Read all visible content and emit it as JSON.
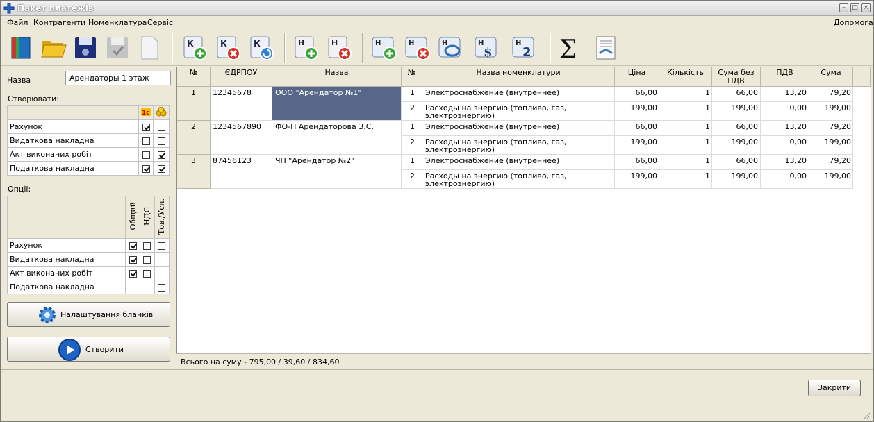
{
  "window": {
    "title": "Пакет платежів"
  },
  "menu": {
    "file": "Файл",
    "contractors": "Контрагенти",
    "nomenclature": "Номенклатура",
    "service": "Сервіс",
    "help": "Допомога"
  },
  "form": {
    "name_label": "Назва",
    "name_value": "Арендаторы 1 этаж",
    "create_label": "Створювати:",
    "options_label": "Опції:"
  },
  "create_table": {
    "rows": [
      {
        "label": "Рахунок",
        "c1": true,
        "c2": false
      },
      {
        "label": "Видаткова накладна",
        "c1": false,
        "c2": false
      },
      {
        "label": "Акт виконаних робіт",
        "c1": false,
        "c2": true
      },
      {
        "label": "Податкова накладна",
        "c1": true,
        "c2": true
      }
    ]
  },
  "options_table": {
    "headers": [
      "Общий",
      "НДС",
      "Тов./Усл."
    ],
    "rows": [
      {
        "label": "Рахунок",
        "c1": true,
        "c2": false,
        "c3": false
      },
      {
        "label": "Видаткова накладна",
        "c1": true,
        "c2": false,
        "c3": null
      },
      {
        "label": "Акт виконаних робіт",
        "c1": true,
        "c2": false,
        "c3": null
      },
      {
        "label": "Податкова накладна",
        "c1": null,
        "c2": null,
        "c3": false
      }
    ]
  },
  "buttons": {
    "settings": "Налаштування бланків",
    "create": "Створити",
    "close": "Закрити"
  },
  "grid": {
    "headers": {
      "num": "№",
      "edrpou": "ЄДРПОУ",
      "name": "Назва",
      "pos": "№",
      "nomen": "Назва номенклатури",
      "price": "Ціна",
      "qty": "Кількість",
      "sum_no_vat": "Сума без ПДВ",
      "vat": "ПДВ",
      "sum": "Сума"
    },
    "rows": [
      {
        "num": "1",
        "edrpou": "12345678",
        "name": "ООО \"Арендатор №1\"",
        "items": [
          {
            "pos": "1",
            "nomen": "Электроснабжение (внутреннее)",
            "nomen2": "",
            "price": "66,00",
            "qty": "1",
            "sum_no_vat": "66,00",
            "vat": "13,20",
            "sum": "79,20"
          },
          {
            "pos": "2",
            "nomen": "Расходы на энергию (топливо, газ,",
            "nomen2": "электроэнергию)",
            "price": "199,00",
            "qty": "1",
            "sum_no_vat": "199,00",
            "vat": "0,00",
            "sum": "199,00"
          }
        ]
      },
      {
        "num": "2",
        "edrpou": "1234567890",
        "name": "ФО-П Арендаторова З.С.",
        "items": [
          {
            "pos": "1",
            "nomen": "Электроснабжение (внутреннее)",
            "nomen2": "",
            "price": "66,00",
            "qty": "1",
            "sum_no_vat": "66,00",
            "vat": "13,20",
            "sum": "79,20"
          },
          {
            "pos": "2",
            "nomen": "Расходы на энергию (топливо, газ,",
            "nomen2": "электроэнергию)",
            "price": "199,00",
            "qty": "1",
            "sum_no_vat": "199,00",
            "vat": "0,00",
            "sum": "199,00"
          }
        ]
      },
      {
        "num": "3",
        "edrpou": "87456123",
        "name": "ЧП \"Арендатор №2\"",
        "items": [
          {
            "pos": "1",
            "nomen": "Электроснабжение (внутреннее)",
            "nomen2": "",
            "price": "66,00",
            "qty": "1",
            "sum_no_vat": "66,00",
            "vat": "13,20",
            "sum": "79,20"
          },
          {
            "pos": "2",
            "nomen": "Расходы на энергию (топливо, газ,",
            "nomen2": "электроэнергию)",
            "price": "199,00",
            "qty": "1",
            "sum_no_vat": "199,00",
            "vat": "0,00",
            "sum": "199,00"
          }
        ]
      }
    ],
    "total": "Всього на суму - 795,00 / 39,60 / 834,60"
  },
  "toolbar": {
    "icons": [
      "book-icon",
      "folder-open-icon",
      "save-disk-icon",
      "save-disabled-icon",
      "blank-page-icon",
      "k-add-icon",
      "k-delete-icon",
      "k-refresh-icon",
      "n-add-icon",
      "n-delete-icon",
      "h-add-icon",
      "h-delete-icon",
      "h-swap-icon",
      "h-price-icon",
      "h-count-icon",
      "sigma-icon",
      "handshake-document-icon"
    ]
  },
  "colors": {
    "selected": "#56678a",
    "titlebar_text": "#ffffff"
  }
}
